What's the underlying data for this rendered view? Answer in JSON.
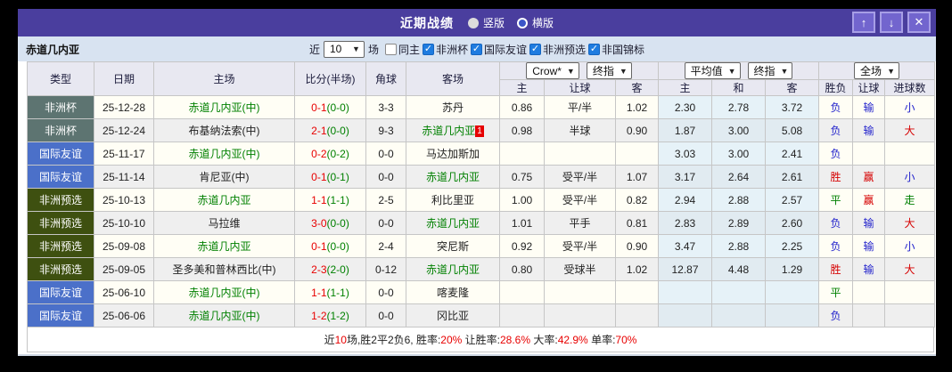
{
  "window": {
    "title": "近期战绩",
    "radios": [
      {
        "name": "vertical",
        "label": "竖版",
        "selected": false
      },
      {
        "name": "horizontal",
        "label": "横版",
        "selected": true
      }
    ],
    "controls": {
      "up": "↑",
      "down": "↓",
      "close": "✕"
    }
  },
  "filter": {
    "team": "赤道几内亚",
    "recent_label": "近",
    "count": "10",
    "matches_label": "场",
    "checkboxes": [
      {
        "name": "same-home",
        "label": "同主",
        "checked": false
      },
      {
        "name": "africa-cup",
        "label": "非洲杯",
        "checked": true
      },
      {
        "name": "intl-friendly",
        "label": "国际友谊",
        "checked": true
      },
      {
        "name": "africa-qualifier",
        "label": "非洲预选",
        "checked": true
      },
      {
        "name": "africa-championship",
        "label": "非国锦标",
        "checked": true
      }
    ]
  },
  "table": {
    "left_headers": [
      "类型",
      "日期",
      "主场",
      "比分(半场)",
      "角球",
      "客场"
    ],
    "sub_headers": [
      "主",
      "让球",
      "客",
      "主",
      "和",
      "客",
      "胜负",
      "让球",
      "进球数"
    ],
    "selects": {
      "bookmaker": "Crow*",
      "bookmaker_final": "终指",
      "average": "平均值",
      "average_final": "终指",
      "scope": "全场"
    },
    "rows": [
      {
        "type": {
          "label": "非洲杯",
          "cls": "cup"
        },
        "date": "25-12-28",
        "home": {
          "name": "赤道几内亚(中)",
          "green": true
        },
        "score": {
          "ft": "0-1",
          "ht": "(0-0)"
        },
        "corner": "3-3",
        "away": {
          "name": "苏丹",
          "green": false
        },
        "odds": {
          "home": "0.86",
          "hcap": "平/半",
          "away": "1.02"
        },
        "avg": {
          "home": "2.30",
          "draw": "2.78",
          "away": "3.72"
        },
        "result": {
          "wdl": {
            "t": "负",
            "c": "blue"
          },
          "hcap": {
            "t": "输",
            "c": "blue"
          },
          "goals": {
            "t": "小",
            "c": "blue"
          }
        }
      },
      {
        "type": {
          "label": "非洲杯",
          "cls": "cup"
        },
        "date": "25-12-24",
        "home": {
          "name": "布基纳法索(中)",
          "green": false
        },
        "score": {
          "ft": "2-1",
          "ht": "(0-0)"
        },
        "corner": "9-3",
        "away": {
          "name": "赤道几内亚",
          "green": true,
          "badge": "1"
        },
        "odds": {
          "home": "0.98",
          "hcap": "半球",
          "away": "0.90"
        },
        "avg": {
          "home": "1.87",
          "draw": "3.00",
          "away": "5.08"
        },
        "result": {
          "wdl": {
            "t": "负",
            "c": "blue"
          },
          "hcap": {
            "t": "输",
            "c": "blue"
          },
          "goals": {
            "t": "大",
            "c": "red"
          }
        }
      },
      {
        "type": {
          "label": "国际友谊",
          "cls": "friendly"
        },
        "date": "25-11-17",
        "home": {
          "name": "赤道几内亚(中)",
          "green": true
        },
        "score": {
          "ft": "0-2",
          "ht": "(0-2)"
        },
        "corner": "0-0",
        "away": {
          "name": "马达加斯加",
          "green": false
        },
        "odds": {
          "home": "",
          "hcap": "",
          "away": ""
        },
        "avg": {
          "home": "3.03",
          "draw": "3.00",
          "away": "2.41"
        },
        "result": {
          "wdl": {
            "t": "负",
            "c": "blue"
          },
          "hcap": null,
          "goals": null
        }
      },
      {
        "type": {
          "label": "国际友谊",
          "cls": "friendly"
        },
        "date": "25-11-14",
        "home": {
          "name": "肯尼亚(中)",
          "green": false
        },
        "score": {
          "ft": "0-1",
          "ht": "(0-1)"
        },
        "corner": "0-0",
        "away": {
          "name": "赤道几内亚",
          "green": true
        },
        "odds": {
          "home": "0.75",
          "hcap": "受平/半",
          "away": "1.07"
        },
        "avg": {
          "home": "3.17",
          "draw": "2.64",
          "away": "2.61"
        },
        "result": {
          "wdl": {
            "t": "胜",
            "c": "red"
          },
          "hcap": {
            "t": "赢",
            "c": "red"
          },
          "goals": {
            "t": "小",
            "c": "blue"
          }
        }
      },
      {
        "type": {
          "label": "非洲预选",
          "cls": "qualifier"
        },
        "date": "25-10-13",
        "home": {
          "name": "赤道几内亚",
          "green": true
        },
        "score": {
          "ft": "1-1",
          "ht": "(1-1)"
        },
        "corner": "2-5",
        "away": {
          "name": "利比里亚",
          "green": false
        },
        "odds": {
          "home": "1.00",
          "hcap": "受平/半",
          "away": "0.82"
        },
        "avg": {
          "home": "2.94",
          "draw": "2.88",
          "away": "2.57"
        },
        "result": {
          "wdl": {
            "t": "平",
            "c": "green"
          },
          "hcap": {
            "t": "赢",
            "c": "red"
          },
          "goals": {
            "t": "走",
            "c": "green"
          }
        }
      },
      {
        "type": {
          "label": "非洲预选",
          "cls": "qualifier"
        },
        "date": "25-10-10",
        "home": {
          "name": "马拉维",
          "green": false
        },
        "score": {
          "ft": "3-0",
          "ht": "(0-0)"
        },
        "corner": "0-0",
        "away": {
          "name": "赤道几内亚",
          "green": true
        },
        "odds": {
          "home": "1.01",
          "hcap": "平手",
          "away": "0.81"
        },
        "avg": {
          "home": "2.83",
          "draw": "2.89",
          "away": "2.60"
        },
        "result": {
          "wdl": {
            "t": "负",
            "c": "blue"
          },
          "hcap": {
            "t": "输",
            "c": "blue"
          },
          "goals": {
            "t": "大",
            "c": "red"
          }
        }
      },
      {
        "type": {
          "label": "非洲预选",
          "cls": "qualifier"
        },
        "date": "25-09-08",
        "home": {
          "name": "赤道几内亚",
          "green": true
        },
        "score": {
          "ft": "0-1",
          "ht": "(0-0)"
        },
        "corner": "2-4",
        "away": {
          "name": "突尼斯",
          "green": false
        },
        "odds": {
          "home": "0.92",
          "hcap": "受平/半",
          "away": "0.90"
        },
        "avg": {
          "home": "3.47",
          "draw": "2.88",
          "away": "2.25"
        },
        "result": {
          "wdl": {
            "t": "负",
            "c": "blue"
          },
          "hcap": {
            "t": "输",
            "c": "blue"
          },
          "goals": {
            "t": "小",
            "c": "blue"
          }
        }
      },
      {
        "type": {
          "label": "非洲预选",
          "cls": "qualifier"
        },
        "date": "25-09-05",
        "home": {
          "name": "圣多美和普林西比(中)",
          "green": false
        },
        "score": {
          "ft": "2-3",
          "ht": "(2-0)"
        },
        "corner": "0-12",
        "away": {
          "name": "赤道几内亚",
          "green": true
        },
        "odds": {
          "home": "0.80",
          "hcap": "受球半",
          "away": "1.02"
        },
        "avg": {
          "home": "12.87",
          "draw": "4.48",
          "away": "1.29"
        },
        "result": {
          "wdl": {
            "t": "胜",
            "c": "red"
          },
          "hcap": {
            "t": "输",
            "c": "blue"
          },
          "goals": {
            "t": "大",
            "c": "red"
          }
        }
      },
      {
        "type": {
          "label": "国际友谊",
          "cls": "friendly"
        },
        "date": "25-06-10",
        "home": {
          "name": "赤道几内亚(中)",
          "green": true
        },
        "score": {
          "ft": "1-1",
          "ht": "(1-1)"
        },
        "corner": "0-0",
        "away": {
          "name": "喀麦隆",
          "green": false
        },
        "odds": {
          "home": "",
          "hcap": "",
          "away": ""
        },
        "avg": {
          "home": "",
          "draw": "",
          "away": ""
        },
        "result": {
          "wdl": {
            "t": "平",
            "c": "green"
          },
          "hcap": null,
          "goals": null
        }
      },
      {
        "type": {
          "label": "国际友谊",
          "cls": "friendly"
        },
        "date": "25-06-06",
        "home": {
          "name": "赤道几内亚(中)",
          "green": true
        },
        "score": {
          "ft": "1-2",
          "ht": "(1-2)"
        },
        "corner": "0-0",
        "away": {
          "name": "冈比亚",
          "green": false
        },
        "odds": {
          "home": "",
          "hcap": "",
          "away": ""
        },
        "avg": {
          "home": "",
          "draw": "",
          "away": ""
        },
        "result": {
          "wdl": {
            "t": "负",
            "c": "blue"
          },
          "hcap": null,
          "goals": null
        }
      }
    ]
  },
  "footer": {
    "segments": [
      {
        "text": "近",
        "red": false
      },
      {
        "text": "10",
        "red": true
      },
      {
        "text": "场,胜2平2负6, 胜率:",
        "red": false
      },
      {
        "text": "20%",
        "red": true
      },
      {
        "text": " 让胜率:",
        "red": false
      },
      {
        "text": "28.6%",
        "red": true
      },
      {
        "text": " 大率:",
        "red": false
      },
      {
        "text": "42.9%",
        "red": true
      },
      {
        "text": " 单率:",
        "red": false
      },
      {
        "text": "70%",
        "red": true
      }
    ]
  },
  "colors": {
    "titlebar_purple": "#4a3e9e",
    "type_africa_cup": "#5d7471",
    "type_friendly": "#4b70c9",
    "type_qualifier": "#3e5010",
    "win_red": "#d60000",
    "draw_green": "#008000",
    "lose_blue": "#2323cc",
    "score_red": "#e80000",
    "focus_team_green": "#008000",
    "checkbox_blue": "#1e7ce0"
  }
}
